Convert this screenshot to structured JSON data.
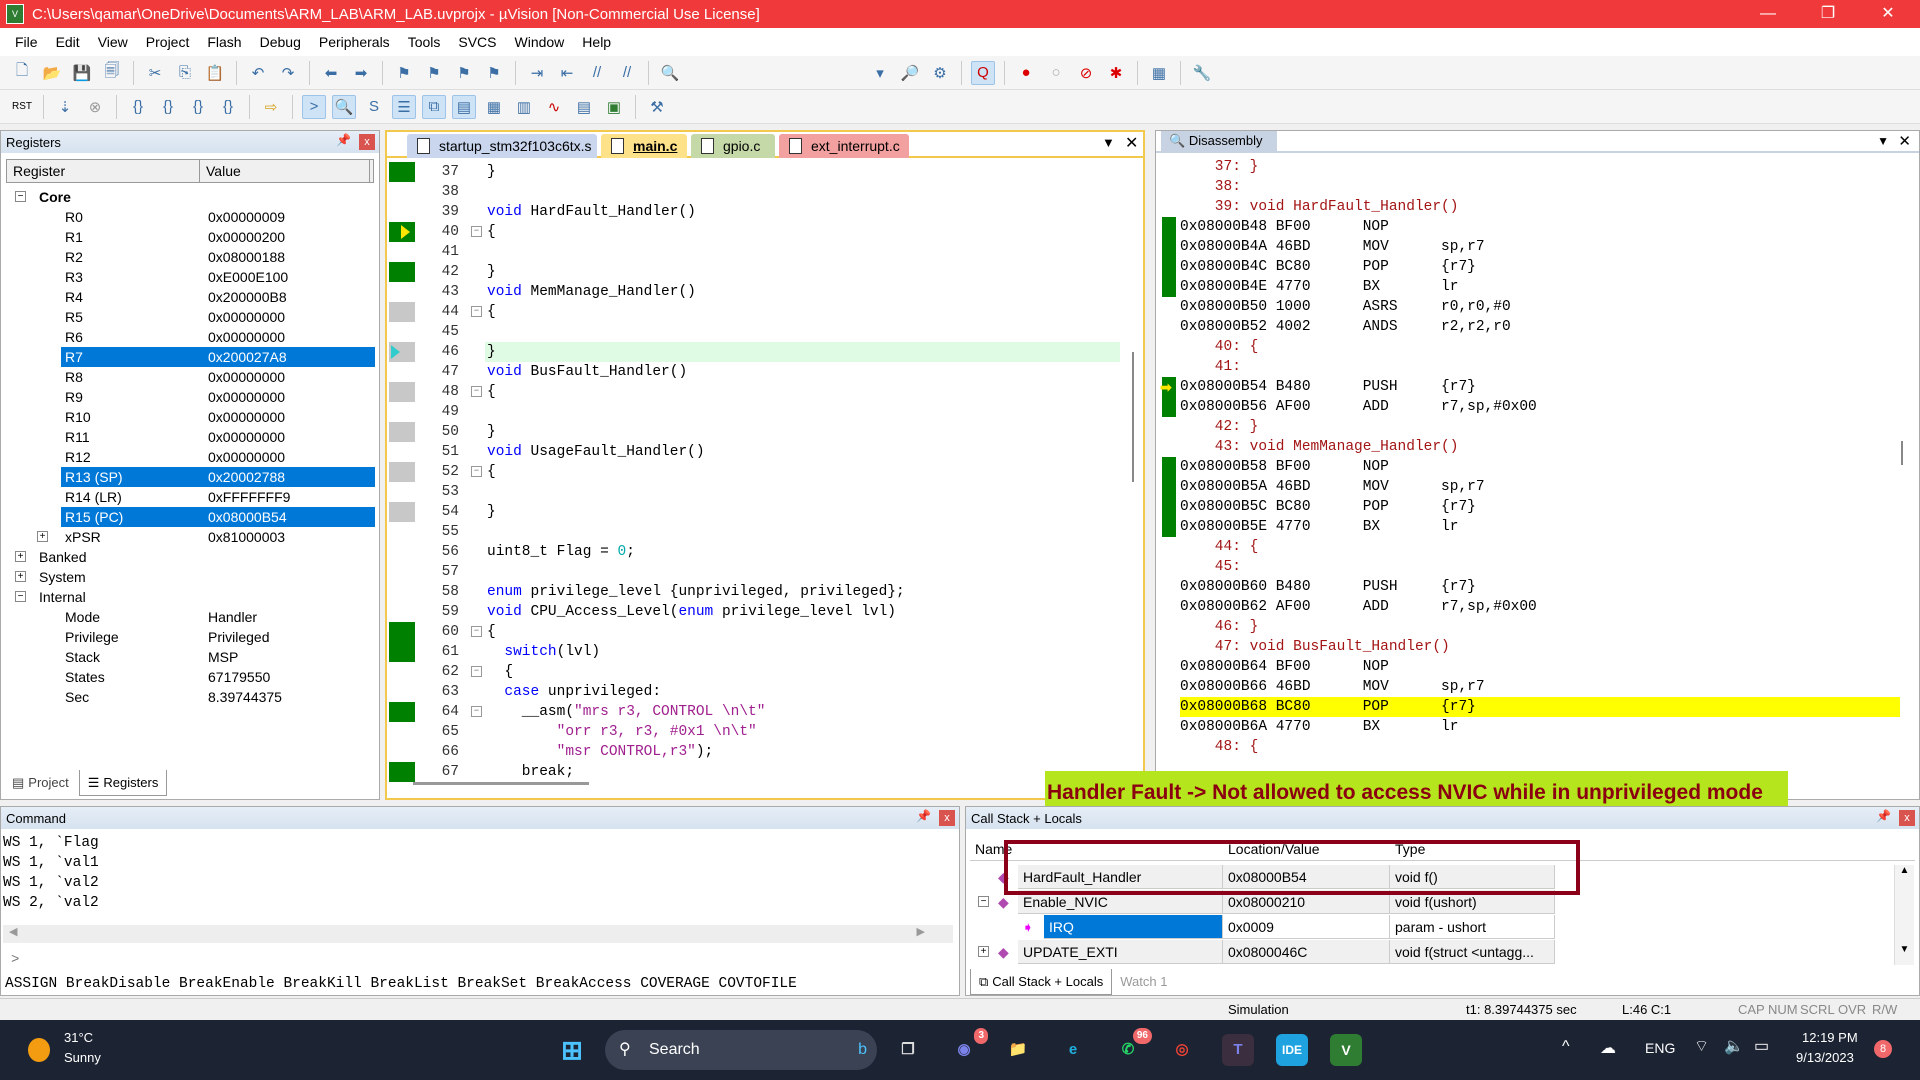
{
  "window": {
    "title": "C:\\Users\\qamar\\OneDrive\\Documents\\ARM_LAB\\ARM_LAB.uvprojx - µVision  [Non-Commercial Use License]",
    "min": "—",
    "max": "❐",
    "close": "✕"
  },
  "menu": [
    "File",
    "Edit",
    "View",
    "Project",
    "Flash",
    "Debug",
    "Peripherals",
    "Tools",
    "SVCS",
    "Window",
    "Help"
  ],
  "registers": {
    "title": "Registers",
    "col_register": "Register",
    "col_value": "Value",
    "groups": {
      "core": "Core",
      "banked": "Banked",
      "system": "System",
      "internal": "Internal"
    },
    "core": [
      [
        "R0",
        "0x00000009"
      ],
      [
        "R1",
        "0x00000200"
      ],
      [
        "R2",
        "0x08000188"
      ],
      [
        "R3",
        "0xE000E100"
      ],
      [
        "R4",
        "0x200000B8"
      ],
      [
        "R5",
        "0x00000000"
      ],
      [
        "R6",
        "0x00000000"
      ],
      [
        "R7",
        "0x200027A8"
      ],
      [
        "R8",
        "0x00000000"
      ],
      [
        "R9",
        "0x00000000"
      ],
      [
        "R10",
        "0x00000000"
      ],
      [
        "R11",
        "0x00000000"
      ],
      [
        "R12",
        "0x00000000"
      ],
      [
        "R13 (SP)",
        "0x20002788"
      ],
      [
        "R14 (LR)",
        "0xFFFFFFF9"
      ],
      [
        "R15 (PC)",
        "0x08000B54"
      ],
      [
        "xPSR",
        "0x81000003"
      ]
    ],
    "selected": [
      "R7",
      "R13 (SP)",
      "R15 (PC)"
    ],
    "internal": [
      [
        "Mode",
        "Handler"
      ],
      [
        "Privilege",
        "Privileged"
      ],
      [
        "Stack",
        "MSP"
      ],
      [
        "States",
        "67179550"
      ],
      [
        "Sec",
        "8.39744375"
      ]
    ],
    "tabs": [
      "Project",
      "Registers"
    ]
  },
  "editor": {
    "tabs": [
      "startup_stm32f103c6tx.s",
      "main.c",
      "gpio.c",
      "ext_interrupt.c"
    ],
    "active_tab": "main.c",
    "lines": [
      {
        "n": "37",
        "g": "green",
        "t": [
          [
            "}",
            ""
          ]
        ]
      },
      {
        "n": "38",
        "t": []
      },
      {
        "n": "39",
        "t": [
          [
            "void",
            "kw"
          ],
          [
            " HardFault_Handler()",
            ""
          ]
        ]
      },
      {
        "n": "40",
        "g": "green",
        "arrow": "yellow",
        "fold": true,
        "t": [
          [
            "{",
            ""
          ]
        ]
      },
      {
        "n": "41",
        "t": []
      },
      {
        "n": "42",
        "g": "green",
        "t": [
          [
            "}",
            ""
          ]
        ]
      },
      {
        "n": "43",
        "t": [
          [
            "void",
            "kw"
          ],
          [
            " MemManage_Handler()",
            ""
          ]
        ]
      },
      {
        "n": "44",
        "g": "gray",
        "fold": true,
        "t": [
          [
            "{",
            ""
          ]
        ]
      },
      {
        "n": "45",
        "t": []
      },
      {
        "n": "46",
        "g": "gray",
        "arrow": "cyan",
        "hl": true,
        "t": [
          [
            "}",
            ""
          ]
        ]
      },
      {
        "n": "47",
        "t": [
          [
            "void",
            "kw"
          ],
          [
            " BusFault_Handler()",
            ""
          ]
        ]
      },
      {
        "n": "48",
        "g": "gray",
        "fold": true,
        "t": [
          [
            "{",
            ""
          ]
        ]
      },
      {
        "n": "49",
        "t": []
      },
      {
        "n": "50",
        "g": "gray",
        "t": [
          [
            "}",
            ""
          ]
        ]
      },
      {
        "n": "51",
        "t": [
          [
            "void",
            "kw"
          ],
          [
            " UsageFault_Handler()",
            ""
          ]
        ]
      },
      {
        "n": "52",
        "g": "gray",
        "fold": true,
        "t": [
          [
            "{",
            ""
          ]
        ]
      },
      {
        "n": "53",
        "t": []
      },
      {
        "n": "54",
        "g": "gray",
        "t": [
          [
            "}",
            ""
          ]
        ]
      },
      {
        "n": "55",
        "t": []
      },
      {
        "n": "56",
        "t": [
          [
            "uint8_t Flag = ",
            ""
          ],
          [
            "0",
            "nm"
          ],
          [
            ";",
            ""
          ]
        ]
      },
      {
        "n": "57",
        "t": []
      },
      {
        "n": "58",
        "t": [
          [
            "enum",
            "kw"
          ],
          [
            " privilege_level {unprivileged, privileged};",
            ""
          ]
        ]
      },
      {
        "n": "59",
        "t": [
          [
            "void",
            "kw"
          ],
          [
            " CPU_Access_Level(",
            ""
          ],
          [
            "enum",
            "kw"
          ],
          [
            " privilege_level lvl)",
            ""
          ]
        ]
      },
      {
        "n": "60",
        "g": "green",
        "fold": true,
        "t": [
          [
            "{",
            ""
          ]
        ]
      },
      {
        "n": "61",
        "g": "green",
        "t": [
          [
            "  ",
            ""
          ],
          [
            "switch",
            "kw"
          ],
          [
            "(lvl)",
            ""
          ]
        ]
      },
      {
        "n": "62",
        "fold": true,
        "t": [
          [
            "  {",
            ""
          ]
        ]
      },
      {
        "n": "63",
        "t": [
          [
            "  ",
            ""
          ],
          [
            "case",
            "kw"
          ],
          [
            " unprivileged:",
            ""
          ]
        ]
      },
      {
        "n": "64",
        "g": "green",
        "fold": true,
        "t": [
          [
            "    __asm(",
            ""
          ],
          [
            "\"mrs r3, CONTROL \\n\\t\"",
            "st"
          ]
        ]
      },
      {
        "n": "65",
        "t": [
          [
            "        ",
            ""
          ],
          [
            "\"orr r3, r3, #0x1 \\n\\t\"",
            "st"
          ]
        ]
      },
      {
        "n": "66",
        "t": [
          [
            "        ",
            ""
          ],
          [
            "\"msr CONTROL,r3\"",
            "st"
          ],
          [
            ");",
            ""
          ]
        ]
      },
      {
        "n": "67",
        "g": "green",
        "t": [
          [
            "    break;",
            ""
          ]
        ]
      }
    ]
  },
  "disassembly": {
    "title": "Disassembly",
    "lines": [
      {
        "s": "    37: }"
      },
      {
        "s": "    38:"
      },
      {
        "s": "    39: void HardFault_Handler()"
      },
      {
        "a": "0x08000B48 BF00      NOP",
        "g": 1
      },
      {
        "a": "0x08000B4A 46BD      MOV      sp,r7",
        "g": 1
      },
      {
        "a": "0x08000B4C BC80      POP      {r7}",
        "g": 1
      },
      {
        "a": "0x08000B4E 4770      BX       lr",
        "g": 1
      },
      {
        "a": "0x08000B50 1000      ASRS     r0,r0,#0"
      },
      {
        "a": "0x08000B52 4002      ANDS     r2,r2,r0"
      },
      {
        "s": "    40: {"
      },
      {
        "s": "    41:"
      },
      {
        "a": "0x08000B54 B480      PUSH     {r7}",
        "g": 1,
        "arrow": 1
      },
      {
        "a": "0x08000B56 AF00      ADD      r7,sp,#0x00",
        "g": 1
      },
      {
        "s": "    42: }"
      },
      {
        "s": "    43: void MemManage_Handler()"
      },
      {
        "a": "0x08000B58 BF00      NOP",
        "g": 1
      },
      {
        "a": "0x08000B5A 46BD      MOV      sp,r7",
        "g": 1
      },
      {
        "a": "0x08000B5C BC80      POP      {r7}",
        "g": 1
      },
      {
        "a": "0x08000B5E 4770      BX       lr",
        "g": 1
      },
      {
        "s": "    44: {"
      },
      {
        "s": "    45:"
      },
      {
        "a": "0x08000B60 B480      PUSH     {r7}"
      },
      {
        "a": "0x08000B62 AF00      ADD      r7,sp,#0x00"
      },
      {
        "s": "    46: }"
      },
      {
        "s": "    47: void BusFault_Handler()"
      },
      {
        "a": "0x08000B64 BF00      NOP"
      },
      {
        "a": "0x08000B66 46BD      MOV      sp,r7"
      },
      {
        "a": "0x08000B68 BC80      POP      {r7}",
        "hl": 1
      },
      {
        "a": "0x08000B6A 4770      BX       lr"
      },
      {
        "s": "    48: {"
      }
    ]
  },
  "command": {
    "title": "Command",
    "lines": [
      "WS 1, `Flag",
      "WS 1, `val1",
      "WS 1, `val2",
      "WS 2, `val2"
    ],
    "prompt": ">",
    "hints": "ASSIGN BreakDisable BreakEnable BreakKill BreakList BreakSet BreakAccess COVERAGE COVTOFILE"
  },
  "callstack": {
    "title": "Call Stack + Locals",
    "cols": [
      "Name",
      "Location/Value",
      "Type"
    ],
    "rows": [
      [
        "HardFault_Handler",
        "0x08000B54",
        "void f()"
      ],
      [
        "Enable_NVIC",
        "0x08000210",
        "void f(ushort)"
      ],
      [
        "IRQ",
        "0x0009",
        "param - ushort"
      ],
      [
        "UPDATE_EXTI",
        "0x0800046C",
        "void f(struct <untagg..."
      ]
    ],
    "tabs": [
      "Call Stack + Locals",
      "Watch 1"
    ]
  },
  "annotation": "Handler Fault -> Not allowed to access NVIC while in unprivileged mode",
  "status": {
    "mode": "Simulation",
    "time": "t1: 8.39744375 sec",
    "pos": "L:46 C:1",
    "caps": "CAP",
    "num": "NUM",
    "scrl": "SCRL",
    "ovr": "OVR",
    "rw": "R/W"
  },
  "taskbar": {
    "temp": "31°C",
    "weather": "Sunny",
    "search": "Search",
    "lang": "ENG",
    "time": "12:19 PM",
    "date": "9/13/2023",
    "notif": "8",
    "badge_teams": "3",
    "badge_whatsapp": "96",
    "ide": "IDE"
  }
}
